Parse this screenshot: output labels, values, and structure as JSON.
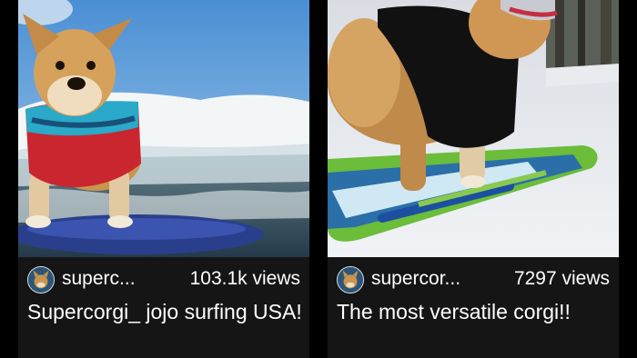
{
  "feed": {
    "videos": [
      {
        "thumbnail_icon": "corgi-surfing-ocean-thumbnail",
        "author": "superc...",
        "views": "103.1k views",
        "title": "Supercorgi_ jojo surfing USA!"
      },
      {
        "thumbnail_icon": "corgi-on-snowboard-thumbnail",
        "author": "supercor...",
        "views": "7297 views",
        "title": "The most versatile corgi!!"
      }
    ]
  },
  "colors": {
    "background": "#000000",
    "card": "#151515",
    "text": "#ffffff",
    "avatar": "#2d5578"
  }
}
